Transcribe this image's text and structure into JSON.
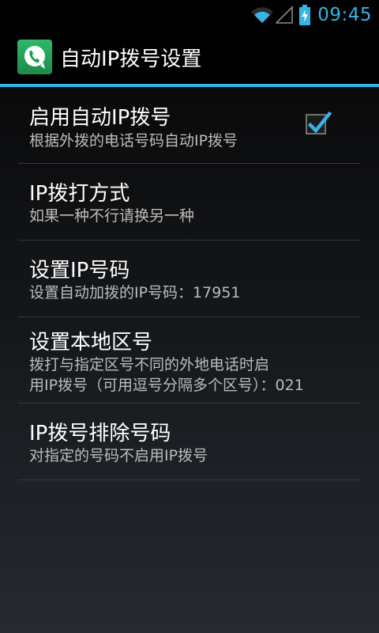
{
  "status_bar": {
    "time": "09:45",
    "icons": [
      "wifi-icon",
      "signal-icon",
      "battery-charging-icon"
    ],
    "accent_color": "#33b5e5"
  },
  "action_bar": {
    "title": "自动IP拨号设置",
    "app_icon": "phone-app-icon",
    "accent_color": "#33b5e5"
  },
  "preferences": [
    {
      "title": "启用自动IP拨号",
      "summary": "根据外拨的电话号码自动IP拨号",
      "checkbox": true,
      "checked": true
    },
    {
      "title": "IP拨打方式",
      "summary": "如果一种不行请换另一种"
    },
    {
      "title": "设置IP号码",
      "summary": "设置自动加拨的IP号码：17951"
    },
    {
      "title": "设置本地区号",
      "summary_lines": [
        "拨打与指定区号不同的外地电话时启",
        "用IP拨号（可用逗号分隔多个区号）：021"
      ]
    },
    {
      "title": "IP拨号排除号码",
      "summary": "对指定的号码不启用IP拨号"
    }
  ]
}
